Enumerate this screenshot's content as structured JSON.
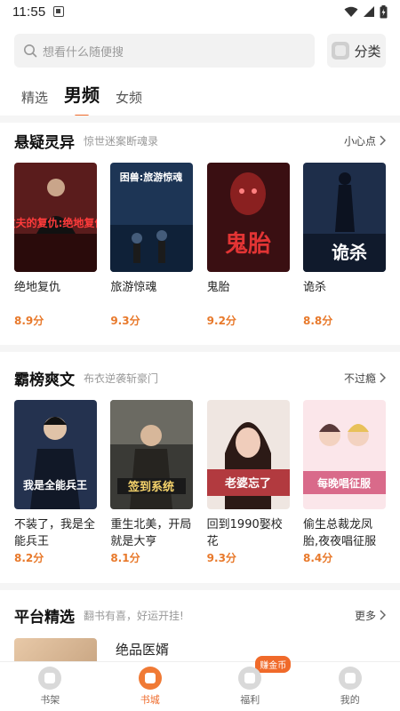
{
  "status_bar": {
    "time": "11:55"
  },
  "search": {
    "placeholder": "想看什么随便搜",
    "category_label": "分类"
  },
  "tabs": [
    {
      "label": "精选",
      "active": false
    },
    {
      "label": "男频",
      "active": true
    },
    {
      "label": "女频",
      "active": false
    }
  ],
  "sections": [
    {
      "title": "悬疑灵异",
      "subtitle": "惊世迷案断魂录",
      "more": "小心点",
      "books": [
        {
          "title": "绝地复仇",
          "score": "8.9分",
          "cover_text": "丈夫的复仇:绝地复仇",
          "cover_color": "#5a1c1c"
        },
        {
          "title": "旅游惊魂",
          "score": "9.3分",
          "cover_text": "困兽:旅游惊魂",
          "cover_color": "#1d3555"
        },
        {
          "title": "鬼胎",
          "score": "9.2分",
          "cover_text": "鬼胎",
          "cover_color": "#3a0f12"
        },
        {
          "title": "诡杀",
          "score": "8.8分",
          "cover_text": "诡杀",
          "cover_color": "#1e2e4a"
        }
      ]
    },
    {
      "title": "霸榜爽文",
      "subtitle": "布衣逆袭斩豪门",
      "more": "不过瘾",
      "books": [
        {
          "title": "不装了，我是全能兵王",
          "score": "8.2分",
          "cover_text": "我是全能兵王",
          "cover_color": "#24324f"
        },
        {
          "title": "重生北美，开局就是大亨",
          "score": "8.1分",
          "cover_text": "签到系统",
          "cover_color": "#3a3a36"
        },
        {
          "title": "回到1990娶校花",
          "score": "9.3分",
          "cover_text": "老婆忘了",
          "cover_color": "#b23a3f"
        },
        {
          "title": "偷生总裁龙凤胎,夜夜唱征服",
          "score": "8.4分",
          "cover_text": "每晚唱征服",
          "cover_color": "#d96a8a"
        }
      ]
    },
    {
      "title": "平台精选",
      "subtitle": "翻书有喜，好运开挂!",
      "more": "更多",
      "books": [
        {
          "title": "绝品医婿"
        }
      ]
    }
  ],
  "bottom_nav": [
    {
      "label": "书架",
      "active": false
    },
    {
      "label": "书城",
      "active": true
    },
    {
      "label": "福利",
      "active": false,
      "badge": "赚金币"
    },
    {
      "label": "我的",
      "active": false
    }
  ],
  "colors": {
    "accent": "#f06a2a",
    "score": "#e8792b"
  }
}
